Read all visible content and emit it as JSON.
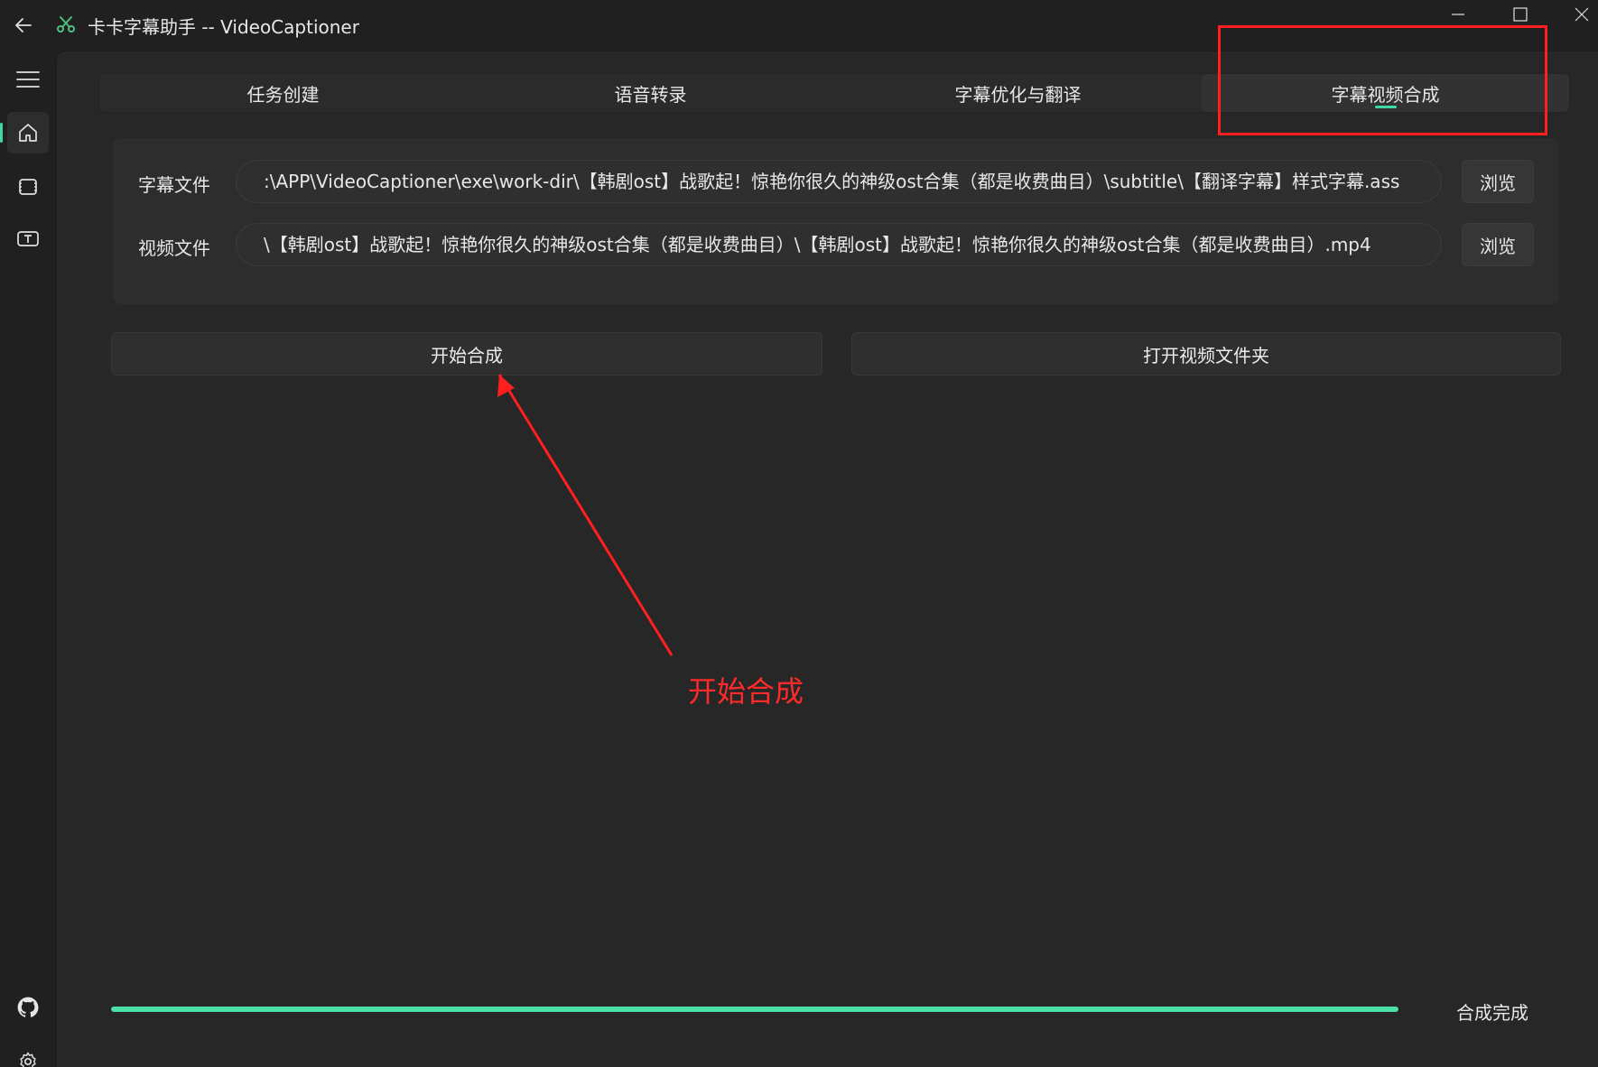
{
  "window": {
    "title": "卡卡字幕助手 -- VideoCaptioner",
    "back_icon": "arrow-left-icon",
    "app_icon": "scissors-icon",
    "controls": [
      "minimize-icon",
      "maximize-icon",
      "close-icon"
    ]
  },
  "nav": {
    "items": [
      {
        "icon": "menu-icon"
      },
      {
        "icon": "home-icon",
        "active": true
      },
      {
        "icon": "video-frame-icon"
      },
      {
        "icon": "subtitle-text-icon"
      }
    ],
    "bottom": [
      {
        "icon": "github-icon"
      },
      {
        "icon": "settings-gear-icon"
      }
    ]
  },
  "tabs": [
    {
      "label": "任务创建",
      "active": false
    },
    {
      "label": "语音转录",
      "active": false
    },
    {
      "label": "字幕优化与翻译",
      "active": false
    },
    {
      "label": "字幕视频合成",
      "active": true
    }
  ],
  "files": {
    "subtitle": {
      "label": "字幕文件",
      "value": ":\\APP\\VideoCaptioner\\exe\\work-dir\\【韩剧ost】战歌起！惊艳你很久的神级ost合集（都是收费曲目）\\subtitle\\【翻译字幕】样式字幕.ass",
      "browse": "浏览"
    },
    "video": {
      "label": "视频文件",
      "value": "\\【韩剧ost】战歌起！惊艳你很久的神级ost合集（都是收费曲目）\\【韩剧ost】战歌起！惊艳你很久的神级ost合集（都是收费曲目）.mp4",
      "browse": "浏览"
    }
  },
  "actions": {
    "start": "开始合成",
    "open_folder": "打开视频文件夹"
  },
  "progress": {
    "value_percent": 100,
    "status": "合成完成"
  },
  "annotations": {
    "callout_text": "开始合成",
    "color": "#ff1f1f"
  },
  "colors": {
    "accent": "#3fd9a0",
    "background": "#202020",
    "panel": "#272727"
  }
}
